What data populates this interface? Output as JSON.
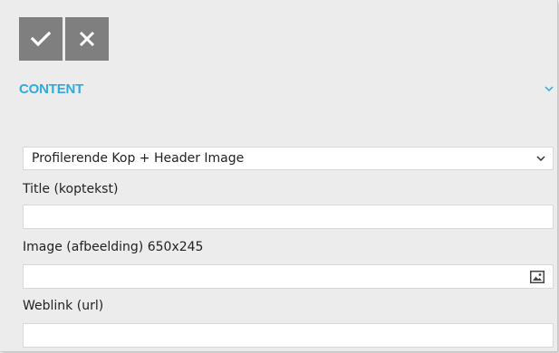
{
  "toolbar": {
    "confirm_icon": "check-icon",
    "cancel_icon": "close-icon",
    "button_color": "#7f7f7f"
  },
  "section": {
    "title": "CONTENT",
    "toggle_icon": "chevron-down-icon",
    "accent_color": "#2eaade"
  },
  "form": {
    "template_select": {
      "value": "Profilerende Kop + Header Image",
      "icon": "chevron-down-icon"
    },
    "fields": {
      "title": {
        "label": "Title (koptekst)",
        "value": ""
      },
      "image": {
        "label": "Image (afbeelding) 650x245",
        "value": "",
        "icon": "image-icon"
      },
      "weblink": {
        "label": "Weblink (url)",
        "value": ""
      }
    }
  }
}
